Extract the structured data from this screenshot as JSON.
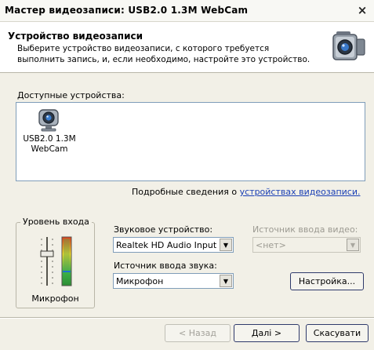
{
  "window": {
    "title": "Мастер видеозаписи: USB2.0 1.3M WebCam",
    "close_glyph": "×"
  },
  "header": {
    "title": "Устройство видеозаписи",
    "description": "Выберите устройство видеозаписи, с которого требуется выполнить запись, и, если  необходимо, настройте это устройство.",
    "icon": "camcorder-icon"
  },
  "devices": {
    "label": "Доступные устройства:",
    "items": [
      {
        "name": "USB2.0 1.3M WebCam",
        "icon": "webcam-icon"
      }
    ]
  },
  "details": {
    "prefix": "Подробные сведения о ",
    "link": "устройствах видеозаписи."
  },
  "input_level": {
    "legend": "Уровень входа",
    "source_label": "Микрофон",
    "colors": {
      "meter_top": "#e33c1c",
      "meter_mid": "#f1dc2a",
      "meter_bottom": "#3fb548"
    }
  },
  "audio": {
    "device_label": "Звуковое устройство:",
    "device_value": "Realtek HD Audio Input",
    "source_label": "Источник ввода звука:",
    "source_value": "Микрофон"
  },
  "video": {
    "source_label": "Источник ввода видео:",
    "source_value": "<нет>"
  },
  "buttons": {
    "settings": "Настройка...",
    "back": "< Назад",
    "next": "Далі >",
    "cancel": "Скасувати"
  }
}
